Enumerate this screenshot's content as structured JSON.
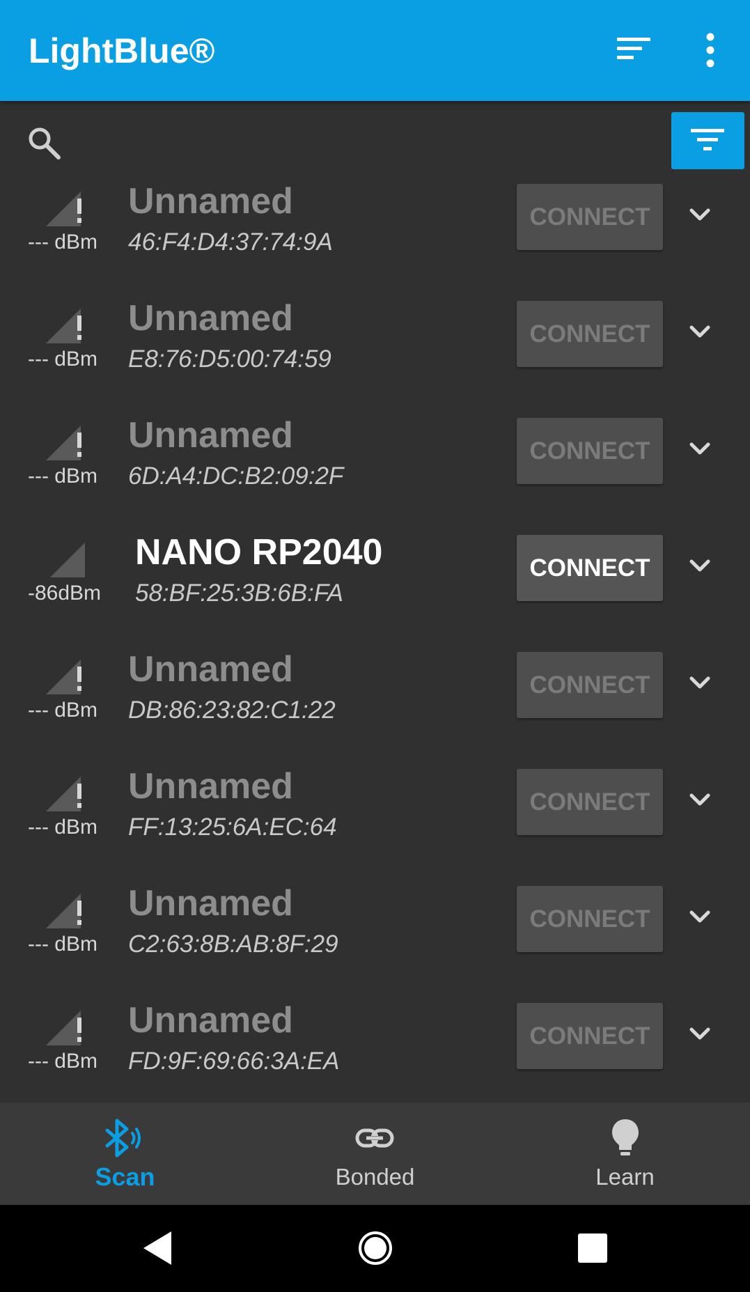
{
  "app": {
    "title": "LightBlue®"
  },
  "icons": {
    "sort": "sort-icon",
    "more": "more-vert-icon",
    "search": "search-icon",
    "filter": "filter-icon",
    "signal": "signal-icon",
    "expand": "chevron-down-icon"
  },
  "colors": {
    "accent": "#0a9ee3",
    "background": "#303030",
    "button": "#4e4e4e"
  },
  "devices": [
    {
      "name": "Unnamed",
      "mac": "46:F4:D4:37:74:9A",
      "rssi": "--- dBm",
      "connect": "CONNECT",
      "active": false
    },
    {
      "name": "Unnamed",
      "mac": "E8:76:D5:00:74:59",
      "rssi": "--- dBm",
      "connect": "CONNECT",
      "active": false
    },
    {
      "name": "Unnamed",
      "mac": "6D:A4:DC:B2:09:2F",
      "rssi": "--- dBm",
      "connect": "CONNECT",
      "active": false
    },
    {
      "name": "NANO RP2040",
      "mac": "58:BF:25:3B:6B:FA",
      "rssi": "-86dBm",
      "connect": "CONNECT",
      "active": true
    },
    {
      "name": "Unnamed",
      "mac": "DB:86:23:82:C1:22",
      "rssi": "--- dBm",
      "connect": "CONNECT",
      "active": false
    },
    {
      "name": "Unnamed",
      "mac": "FF:13:25:6A:EC:64",
      "rssi": "--- dBm",
      "connect": "CONNECT",
      "active": false
    },
    {
      "name": "Unnamed",
      "mac": "C2:63:8B:AB:8F:29",
      "rssi": "--- dBm",
      "connect": "CONNECT",
      "active": false
    },
    {
      "name": "Unnamed",
      "mac": "FD:9F:69:66:3A:EA",
      "rssi": "--- dBm",
      "connect": "CONNECT",
      "active": false
    }
  ],
  "nav": {
    "tabs": [
      {
        "label": "Scan",
        "icon": "bluetooth-searching-icon",
        "selected": true
      },
      {
        "label": "Bonded",
        "icon": "link-icon",
        "selected": false
      },
      {
        "label": "Learn",
        "icon": "lightbulb-icon",
        "selected": false
      }
    ]
  },
  "system_nav": [
    "back-icon",
    "home-icon",
    "recents-icon"
  ]
}
